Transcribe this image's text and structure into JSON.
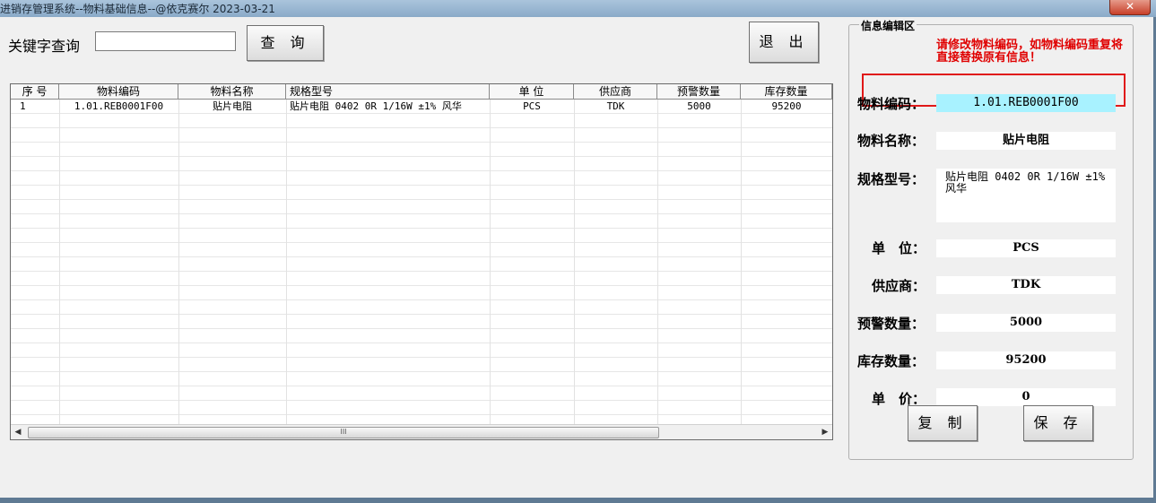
{
  "window": {
    "title": "进销存管理系统--物料基础信息--@依克赛尔 2023-03-21",
    "close_label": "✕"
  },
  "search": {
    "label": "关键字查询",
    "value": "",
    "query_button": "查 询",
    "exit_button": "退 出"
  },
  "grid": {
    "columns": [
      "序 号",
      "物料编码",
      "物料名称",
      "规格型号",
      "单 位",
      "供应商",
      "预警数量",
      "库存数量"
    ],
    "rows": [
      [
        "1",
        "1.01.REB0001F00",
        "贴片电阻",
        "贴片电阻 0402 0R 1/16W ±1% 风华",
        "PCS",
        "TDK",
        "5000",
        "95200"
      ]
    ],
    "scroll_thumb": "III"
  },
  "edit": {
    "legend": "信息编辑区",
    "warning": "请修改物料编码，如物料编码重复将直接替换原有信息！",
    "fields": {
      "code_label": "物料编码：",
      "code_value": "1.01.REB0001F00",
      "name_label": "物料名称：",
      "name_value": "贴片电阻",
      "spec_label": "规格型号：",
      "spec_value": "贴片电阻 0402 0R 1/16W ±1% 风华",
      "unit_label": "单　位：",
      "unit_value": "PCS",
      "supplier_label": "供应商：",
      "supplier_value": "TDK",
      "warn_qty_label": "预警数量：",
      "warn_qty_value": "5000",
      "stock_qty_label": "库存数量：",
      "stock_qty_value": "95200",
      "price_label": "单　价：",
      "price_value": "0"
    },
    "copy_button": "复 制",
    "save_button": "保 存"
  }
}
